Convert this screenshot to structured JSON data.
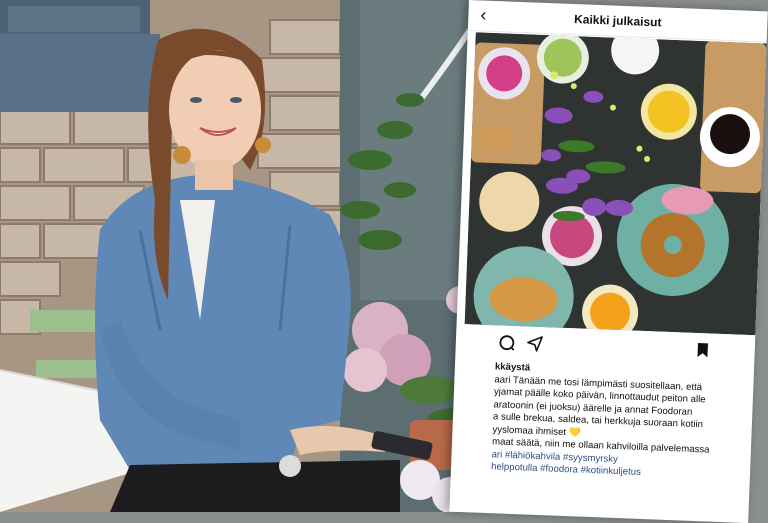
{
  "instagram": {
    "header_title": "Kaikki julkaisut",
    "caption_lines": [
      "kkäystä",
      "aari Tänään me tosi lämpimästi suositellaan, että",
      "yjamat päälle koko päivän, linnottaudut peiton alle",
      "aratoonin (ei juoksu) äärelle ja annat Foodoran",
      "a sulle brekua, saldea, tai herkkuja suoraan kotiin",
      "yyslomaa ihmiset 💛",
      "maat säätä, niin me ollaan kahviloilla palvelemassa",
      "",
      "ari #lähiökahvila #syysmyrsky",
      "helppotulla #foodora #kotiinkuljetus"
    ]
  },
  "icons": {
    "back": "chevron-left-icon",
    "comment": "comment-icon",
    "share": "share-icon",
    "save": "bookmark-icon"
  },
  "colors": {
    "jacket": "#5f86b5",
    "hair": "#7a4a2c",
    "brick": "#b9a999",
    "table_bg": "#2f3432",
    "hashtag": "#2b4e85"
  }
}
